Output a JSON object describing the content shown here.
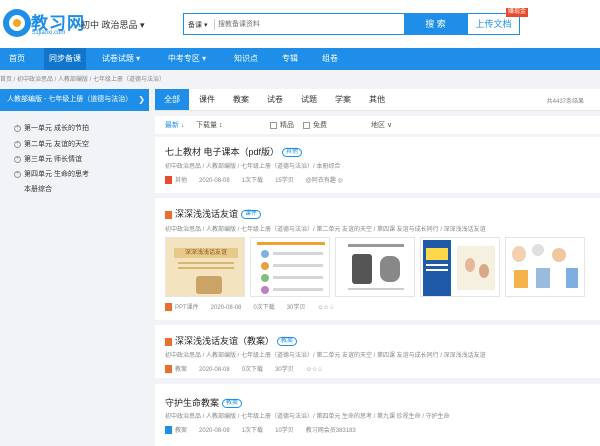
{
  "header": {
    "logo_text": "教习网",
    "logo_domain": "51jiaoxi.com",
    "subject": "初中 政治思品 ▾",
    "search_type": "备课 ▾",
    "search_placeholder": "搜教备课资料",
    "search_button": "搜 索",
    "upload_button": "上传文档",
    "upload_badge": "赚现金"
  },
  "nav": {
    "items": [
      "首页",
      "同步备课",
      "试卷试题 ▾",
      "中考专区 ▾",
      "知识点",
      "专辑",
      "组卷"
    ],
    "active_index": 1
  },
  "breadcrumb": "首页 / 初中政治思品 / 人教部编版 / 七年级上册（道德与法治）",
  "sidebar": {
    "title": "人教部编版 - 七年级上册（道德与法治）",
    "chevron": "❯",
    "units": [
      "第一单元 成长的节拍",
      "第二单元 友谊的天空",
      "第三单元 师长情谊",
      "第四单元 生命的思考",
      "本册综合"
    ]
  },
  "tabs": {
    "items": [
      "全部",
      "课件",
      "教案",
      "试卷",
      "试题",
      "学案",
      "其他"
    ],
    "active_index": 0,
    "result_count": "共4437条结果"
  },
  "filters": {
    "latest": "最新 ↓",
    "downloads": "下载量 ↕",
    "premium": "精品",
    "free": "免费",
    "region": "地区 ∨"
  },
  "cards": [
    {
      "title": "七上教材 电子课本（pdf版）",
      "badge": "其他",
      "path": "初中政治思品 / 人教部编版 / 七年级上册（道德与法治）/ 本册综合",
      "meta": [
        "其他",
        "2020-08-08",
        "1次下载",
        "15学贝",
        "@阿衣有趣 ◎"
      ],
      "type_color": "#e84a2c"
    },
    {
      "title": "深深浅浅话友谊",
      "badge": "课件",
      "path": "初中政治思品 / 人教部编版 / 七年级上册（道德与法治）/ 第二单元 友谊的天空 / 第四课 友谊与成长同行 / 深深浅浅话友谊",
      "meta": [
        "PPT课件",
        "2020-08-08",
        "0次下载",
        "30学贝",
        "☺☆♤"
      ],
      "type_color": "#e8702c",
      "thumb_title": "深深浅浅话友谊"
    },
    {
      "title": "深深浅浅话友谊（教案）",
      "badge": "教案",
      "path": "初中政治思品 / 人教部编版 / 七年级上册（道德与法治）/ 第二单元 友谊的天空 / 第四课 友谊与成长同行 / 深深浅浅话友谊",
      "meta": [
        "教案",
        "2020-08-08",
        "0次下载",
        "30学贝",
        "☺☆♤"
      ],
      "type_color": "#1e8ee8"
    },
    {
      "title": "守护生命教案",
      "badge": "教案",
      "path": "初中政治思品 / 人教部编版 / 七年级上册（道德与法治）/ 第四单元 生命的思考 / 第九课 珍视生命 / 守护生命",
      "meta": [
        "教案",
        "2020-08-08",
        "1次下载",
        "10学贝",
        "教习网会员383183"
      ],
      "type_color": "#1e8ee8"
    }
  ]
}
